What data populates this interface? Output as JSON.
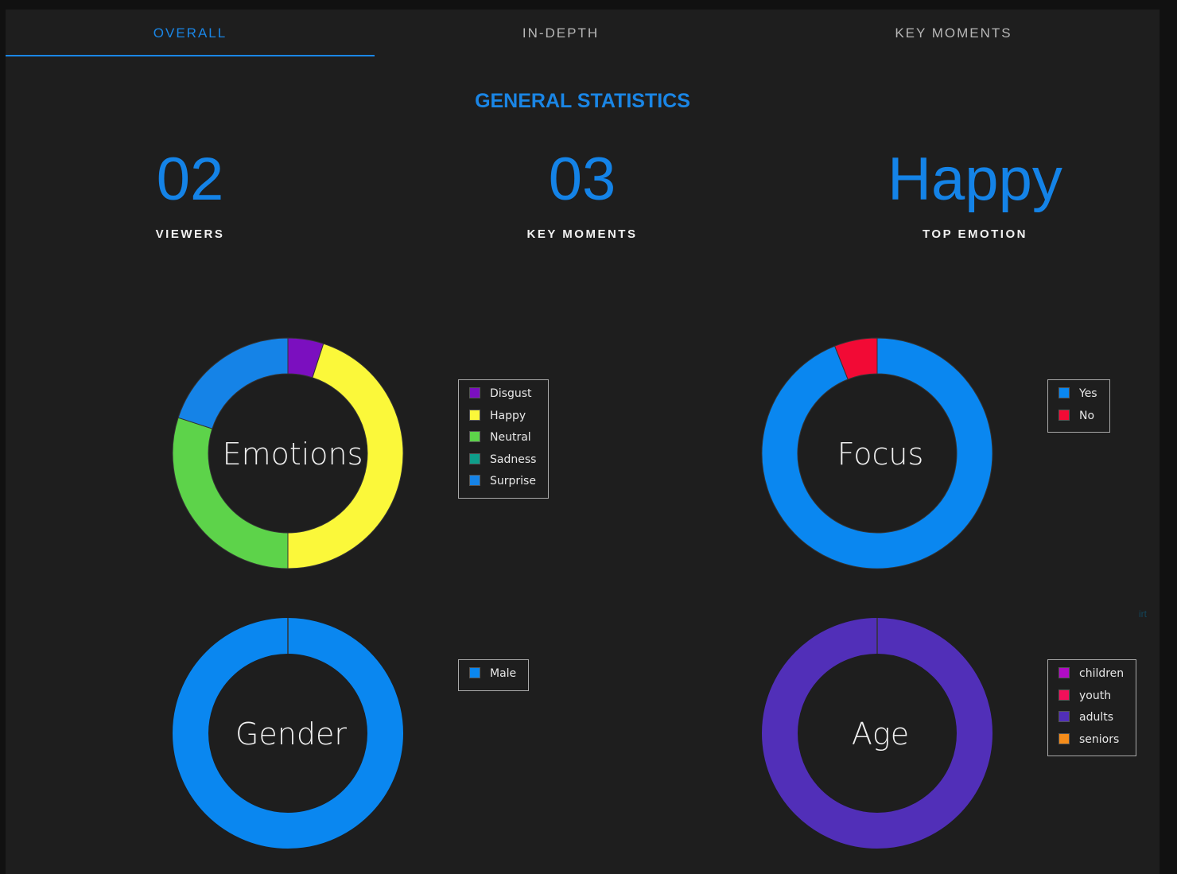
{
  "tabs": [
    {
      "label": "OVERALL",
      "active": true
    },
    {
      "label": "IN-DEPTH",
      "active": false
    },
    {
      "label": "KEY MOMENTS",
      "active": false
    }
  ],
  "section_title": "GENERAL STATISTICS",
  "stats": {
    "viewers": {
      "value": "02",
      "label": "VIEWERS"
    },
    "key_moments": {
      "value": "03",
      "label": "KEY MOMENTS"
    },
    "top_emotion": {
      "value": "Happy",
      "label": "TOP EMOTION"
    }
  },
  "stray_text": "irt",
  "colors": {
    "accent": "#1a86e6",
    "background": "#1e1e1e"
  },
  "chart_data": [
    {
      "type": "pie",
      "title": "Emotions",
      "categories": [
        "Disgust",
        "Happy",
        "Neutral",
        "Sadness",
        "Surprise"
      ],
      "values": [
        5,
        45,
        30,
        0,
        20
      ],
      "colors": [
        "#7b0fbf",
        "#fbf83a",
        "#5dd34a",
        "#0e9e8a",
        "#1583e7"
      ],
      "legend": "right"
    },
    {
      "type": "pie",
      "title": "Focus",
      "categories": [
        "Yes",
        "No"
      ],
      "values": [
        94,
        6
      ],
      "colors": [
        "#0a87f0",
        "#f20a35"
      ],
      "legend": "right"
    },
    {
      "type": "pie",
      "title": "Gender",
      "categories": [
        "Male"
      ],
      "values": [
        100
      ],
      "colors": [
        "#0a87f0"
      ],
      "legend": "right"
    },
    {
      "type": "pie",
      "title": "Age",
      "categories": [
        "children",
        "youth",
        "adults",
        "seniors"
      ],
      "values": [
        0,
        0,
        100,
        0
      ],
      "colors": [
        "#b10bc4",
        "#f2105a",
        "#512fb8",
        "#f58c1a"
      ],
      "legend": "right"
    }
  ]
}
